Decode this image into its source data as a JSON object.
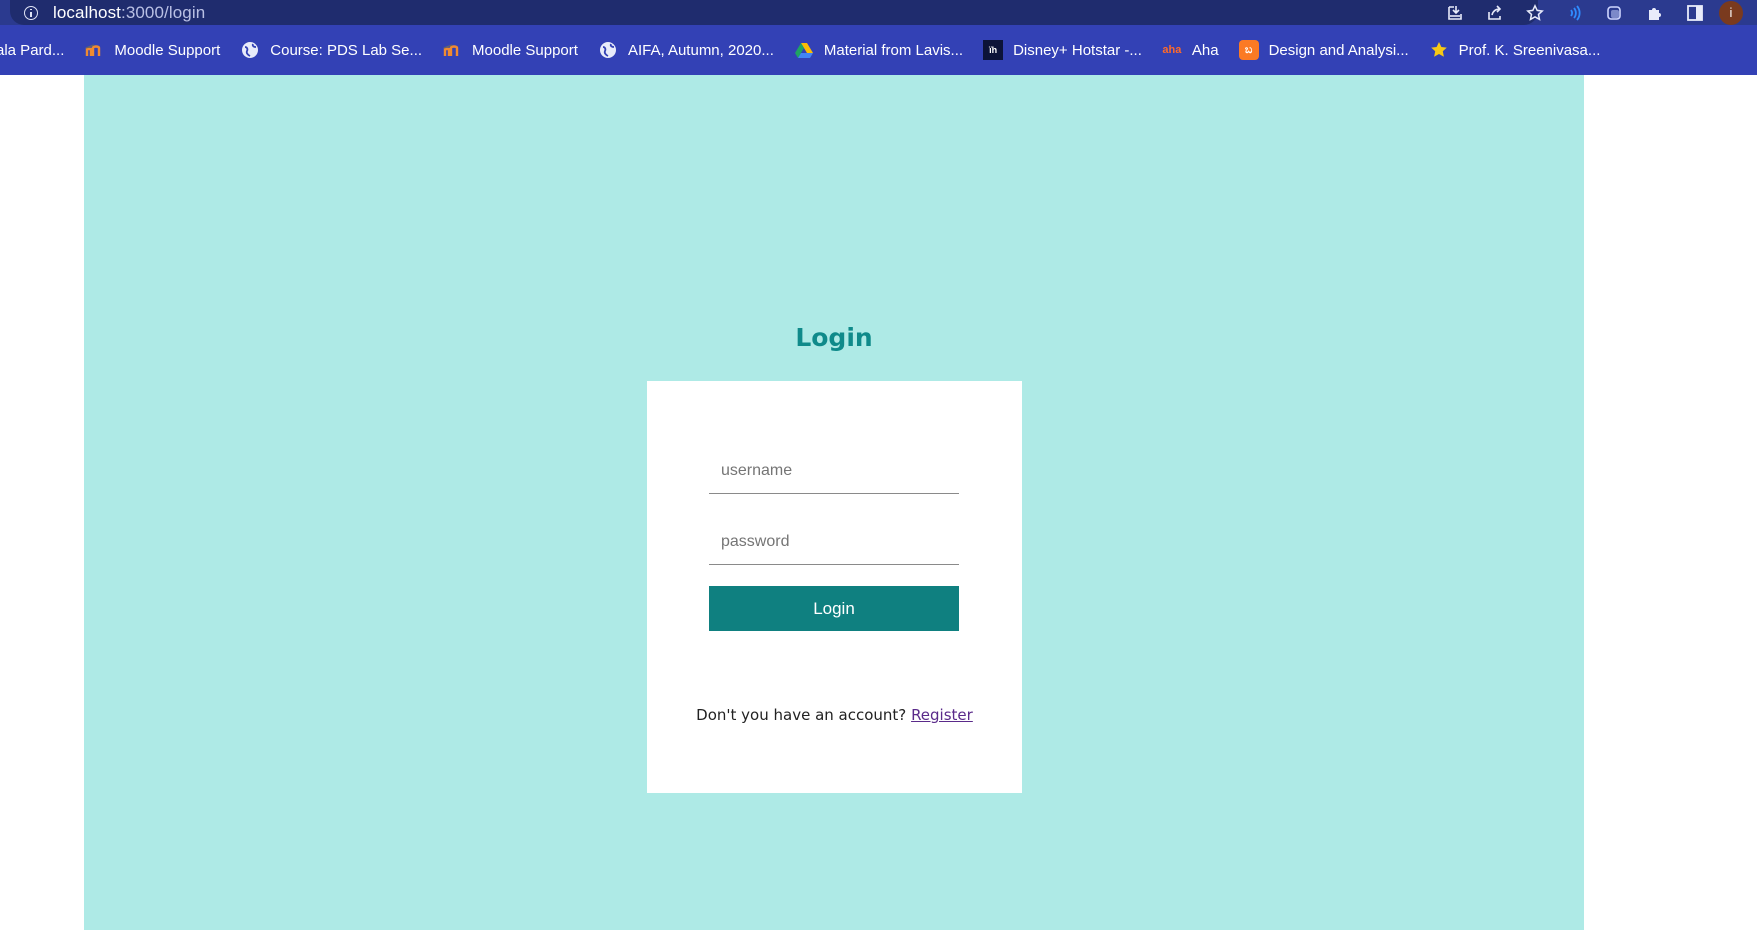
{
  "browser": {
    "url_host": "localhost",
    "url_path": ":3000/login",
    "toolbar_icons": [
      "install-icon",
      "share-icon",
      "star-icon",
      "read-aloud-icon",
      "edge-icon",
      "extensions-icon",
      "sidebar-icon"
    ],
    "profile_initial": "i",
    "bookmarks": [
      {
        "label": "ala Pard...",
        "icon": "none"
      },
      {
        "label": "Moodle Support",
        "icon": "moodle-icon"
      },
      {
        "label": "Course: PDS Lab Se...",
        "icon": "globe-icon"
      },
      {
        "label": "Moodle Support",
        "icon": "moodle-icon"
      },
      {
        "label": "AIFA, Autumn, 2020...",
        "icon": "globe-icon"
      },
      {
        "label": "Material from Lavis...",
        "icon": "drive-icon"
      },
      {
        "label": "Disney+ Hotstar -...",
        "icon": "hotstar-icon"
      },
      {
        "label": "Aha",
        "icon": "aha-icon"
      },
      {
        "label": "Design and Analysi...",
        "icon": "xampp-icon"
      },
      {
        "label": "Prof. K. Sreenivasa...",
        "icon": "star-icon"
      }
    ]
  },
  "page": {
    "title": "Login",
    "background_color": "#aeeae6",
    "accent_color": "#0f8080",
    "form": {
      "username_placeholder": "username",
      "password_placeholder": "password",
      "submit_label": "Login"
    },
    "footer": {
      "prompt": "Don't you have an account?",
      "register_label": "Register"
    }
  }
}
